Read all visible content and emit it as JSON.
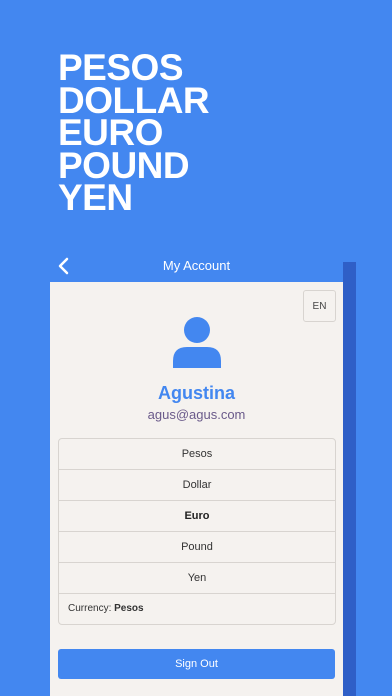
{
  "hero": {
    "lines": [
      "PESOS",
      "DOLLAR",
      "EURO",
      "POUND",
      "YEN"
    ]
  },
  "header": {
    "title": "My Account",
    "back_icon": "chevron-left-icon"
  },
  "lang_button": "EN",
  "profile": {
    "avatar_icon": "user-avatar-icon",
    "name": "Agustina",
    "email": "agus@agus.com"
  },
  "currency_list": {
    "items": [
      {
        "label": "Pesos",
        "selected": false
      },
      {
        "label": "Dollar",
        "selected": false
      },
      {
        "label": "Euro",
        "selected": true
      },
      {
        "label": "Pound",
        "selected": false
      },
      {
        "label": "Yen",
        "selected": false
      }
    ],
    "current_label": "Currency:",
    "current_value": "Pesos"
  },
  "sign_out_label": "Sign Out",
  "colors": {
    "accent": "#4387f0",
    "card_bg": "#f5f2ef",
    "email_text": "#6a5a8a"
  }
}
